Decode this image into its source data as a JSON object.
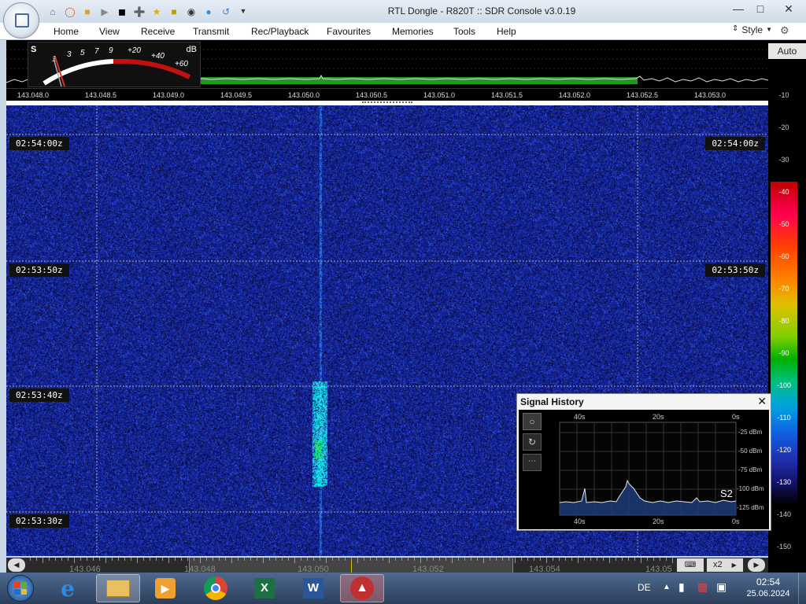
{
  "window": {
    "title": "RTL Dongle - R820T :: SDR Console v3.0.19",
    "controls": {
      "minimize": "—",
      "maximize": "□",
      "close": "✕"
    }
  },
  "quick_access": [
    "home-icon",
    "lifebuoy-icon",
    "folder-icon",
    "play-icon",
    "stop-icon",
    "add-icon",
    "star-icon",
    "lock-icon",
    "camera-icon",
    "drop-icon",
    "arrow-icon"
  ],
  "menu": {
    "items": [
      "Home",
      "View",
      "Receive",
      "Transmit",
      "Rec/Playback",
      "Favourites",
      "Memories",
      "Tools",
      "Help"
    ],
    "style_label": "Style"
  },
  "smeter": {
    "s_label": "S",
    "db_label": "dB",
    "s_ticks": [
      "1",
      "3",
      "5",
      "7",
      "9"
    ],
    "db_ticks": [
      "+20",
      "+40",
      "+60"
    ]
  },
  "spectrum": {
    "freq_labels": [
      "143.048.0",
      "143.048.5",
      "143.049.0",
      "143.049.5",
      "143.050.0",
      "143.050.5",
      "143.051.0",
      "143.051.5",
      "143.052.0",
      "143.052.5",
      "143.053.0"
    ]
  },
  "waterfall": {
    "time_labels": [
      "02:54:00z",
      "02:53:50z",
      "02:53:40z",
      "02:53:30z"
    ]
  },
  "db_scale": {
    "auto_label": "Auto",
    "ticks": [
      "-10",
      "-20",
      "-30",
      "-40",
      "-50",
      "-60",
      "-70",
      "-80",
      "-90",
      "-100",
      "-110",
      "-120",
      "-130",
      "-140",
      "-150"
    ]
  },
  "signal_history": {
    "title": "Signal History",
    "top_axis": [
      "40s",
      "20s",
      "0s"
    ],
    "bottom_axis": [
      "40s",
      "20s",
      "0s"
    ],
    "db_labels": [
      "-25 dBm",
      "-50 dBm",
      "-75 dBm",
      "-100 dBm",
      "-125 dBm"
    ],
    "s_reading": "S2",
    "close": "✕"
  },
  "bottom_bar": {
    "freq_labels": [
      "143.046",
      "143.048",
      "143.050",
      "143.052",
      "143.054",
      "143.05"
    ],
    "zoom": "x2"
  },
  "taskbar": {
    "apps": [
      "internet-explorer-icon",
      "file-explorer-icon",
      "media-player-icon",
      "chrome-icon",
      "excel-icon",
      "word-icon",
      "sdr-console-icon"
    ],
    "lang": "DE",
    "time": "02:54",
    "date": "25.06.2024"
  }
}
